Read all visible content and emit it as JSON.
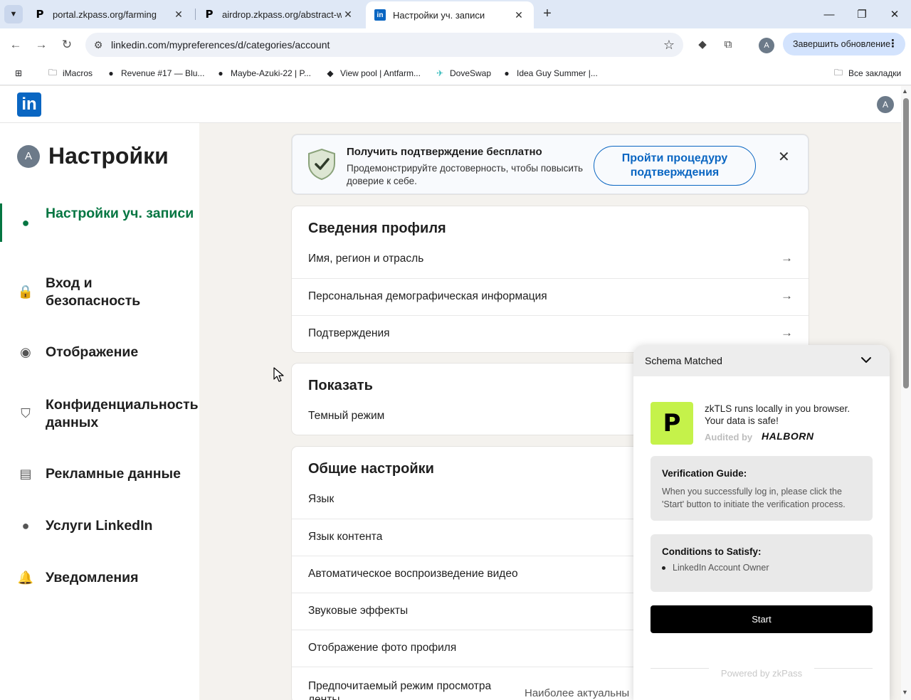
{
  "browser": {
    "tabs": [
      {
        "title": "portal.zkpass.org/farming",
        "favicon": "P"
      },
      {
        "title": "airdrop.zkpass.org/abstract-wal",
        "favicon": "P"
      },
      {
        "title": "Настройки уч. записи",
        "favicon": "in"
      }
    ],
    "url": "linkedin.com/mypreferences/d/categories/account",
    "profile_initial": "A",
    "update_button": "Завершить обновление",
    "bookmarks": [
      {
        "label": "iMacros",
        "icon": "folder-icon"
      },
      {
        "label": "Revenue #17 — Blu...",
        "icon": "avatar-icon"
      },
      {
        "label": "Maybe-Azuki-22 | P...",
        "icon": "avatar-icon"
      },
      {
        "label": "View pool | Antfarm...",
        "icon": "diamond-icon"
      },
      {
        "label": "DoveSwap",
        "icon": "dove-icon"
      },
      {
        "label": "Idea Guy Summer |...",
        "icon": "avatar-icon"
      }
    ],
    "all_bookmarks": "Все закладки"
  },
  "linkedin": {
    "logo": "in",
    "avatar_initial": "A",
    "sidebar": {
      "title": "Настройки",
      "avatar_initial": "A",
      "items": [
        {
          "label": "Настройки уч. записи",
          "icon": "person-icon",
          "active": true
        },
        {
          "label": "Вход и безопасность",
          "icon": "lock-icon"
        },
        {
          "label": "Отображение",
          "icon": "eye-icon"
        },
        {
          "label": "Конфиденциальность данных",
          "icon": "shield-icon"
        },
        {
          "label": "Рекламные данные",
          "icon": "newspaper-icon"
        },
        {
          "label": "Услуги LinkedIn",
          "icon": "person-icon"
        },
        {
          "label": "Уведомления",
          "icon": "bell-icon"
        }
      ]
    },
    "banner": {
      "title": "Получить подтверждение бесплатно",
      "description": "Продемонстрируйте достоверность, чтобы повысить доверие к себе.",
      "button": "Пройти процедуру подтверждения"
    },
    "sections": {
      "profile": {
        "title": "Сведения профиля",
        "rows": [
          "Имя, регион и отрасль",
          "Персональная демографическая информация",
          "Подтверждения"
        ]
      },
      "display": {
        "title": "Показать",
        "rows": [
          "Темный режим"
        ]
      },
      "general": {
        "title": "Общие настройки",
        "rows": [
          "Язык",
          "Язык контента",
          "Автоматическое воспроизведение видео",
          "Звуковые эффекты",
          "Отображение фото профиля",
          "Предпочитаемый режим просмотра ленты"
        ],
        "last_value": "Наиболее актуальны"
      }
    }
  },
  "zkpass": {
    "header": "Schema Matched",
    "logo": "P",
    "message": "zkTLS runs locally in you browser. Your data is safe!",
    "audited_by": "Audited by",
    "auditor": "HALBORN",
    "guide_title": "Verification Guide:",
    "guide_body": "When you successfully log in, please click the 'Start' button to initiate the verification process.",
    "conditions_title": "Conditions to Satisfy:",
    "conditions": [
      "LinkedIn Account Owner"
    ],
    "start_button": "Start",
    "footer": "Powered by zkPass",
    "accent_color": "#c5f24a"
  }
}
